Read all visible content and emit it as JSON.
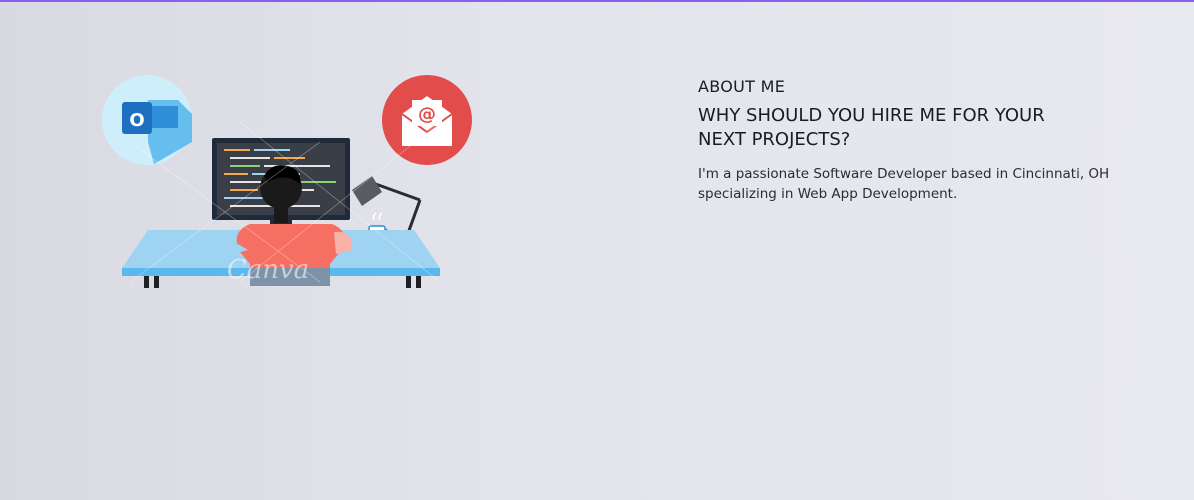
{
  "about": {
    "eyebrow": "ABOUT ME",
    "headline": "WHY SHOULD YOU HIRE ME FOR YOUR NEXT PROJECTS?",
    "bio": "I'm a passionate Software Developer based in Cincinnati, OH specializing in Web App Development."
  },
  "illustration": {
    "watermark": "Canva",
    "outlook_letter": "O",
    "icons": [
      "outlook-icon",
      "email-icon",
      "monitor-icon",
      "desk-lamp-icon",
      "coffee-cup-icon",
      "developer-figure"
    ]
  },
  "colors": {
    "accent_line": "#8d5cf0",
    "email_circle": "#e24c4b",
    "outlook_circle": "#cfeefc",
    "desk": "#9fd3f2",
    "shirt": "#f76e63"
  }
}
